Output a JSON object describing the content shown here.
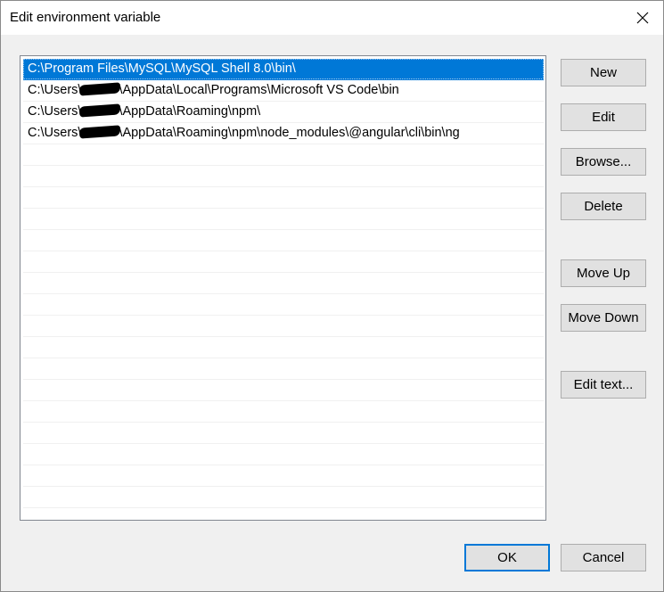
{
  "window": {
    "title": "Edit environment variable",
    "close_glyph": "✕"
  },
  "list": {
    "rows": [
      {
        "text": "C:\\Program Files\\MySQL\\MySQL Shell 8.0\\bin\\",
        "selected": true
      },
      {
        "pre": "C:\\Users\\",
        "post": "\\AppData\\Local\\Programs\\Microsoft VS Code\\bin",
        "redacted": true
      },
      {
        "pre": "C:\\Users\\",
        "post": "\\AppData\\Roaming\\npm\\",
        "redacted": true
      },
      {
        "pre": "C:\\Users\\",
        "post": "\\AppData\\Roaming\\npm\\node_modules\\@angular\\cli\\bin\\ng",
        "redacted": true
      }
    ],
    "empty_row_count": 17
  },
  "buttons": {
    "new": "New",
    "edit": "Edit",
    "browse": "Browse...",
    "delete": "Delete",
    "move_up": "Move Up",
    "move_down": "Move Down",
    "edit_text": "Edit text...",
    "ok": "OK",
    "cancel": "Cancel"
  },
  "colors": {
    "selection": "#0078d7",
    "default_button_border": "#0078d7"
  }
}
